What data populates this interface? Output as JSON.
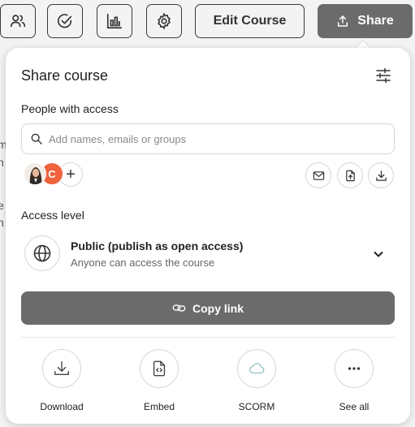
{
  "toolbar": {
    "edit_label": "Edit Course",
    "share_label": "Share",
    "icons": [
      "users-icon",
      "check-circle-icon",
      "bar-chart-icon",
      "gear-icon"
    ]
  },
  "background_edge": [
    "m",
    "n",
    "e",
    "n"
  ],
  "panel": {
    "title": "Share course",
    "people_label": "People with access",
    "search_placeholder": "Add names, emails or groups",
    "avatars": [
      {
        "type": "photo"
      },
      {
        "type": "initial",
        "text": "C",
        "color": "#f0623d"
      }
    ],
    "add_symbol": "+",
    "access_label": "Access level",
    "access": {
      "title": "Public (publish as open access)",
      "subtitle": "Anyone can access the course"
    },
    "copy_label": "Copy link",
    "actions": [
      {
        "label": "Download",
        "icon": "download-icon"
      },
      {
        "label": "Embed",
        "icon": "embed-icon"
      },
      {
        "label": "SCORM",
        "icon": "cloud-icon"
      },
      {
        "label": "See all",
        "icon": "more-icon"
      }
    ]
  },
  "colors": {
    "primary_button": "#6b6b6b",
    "avatar_c": "#f0623d",
    "scorm_icon": "#9ac3c4"
  }
}
